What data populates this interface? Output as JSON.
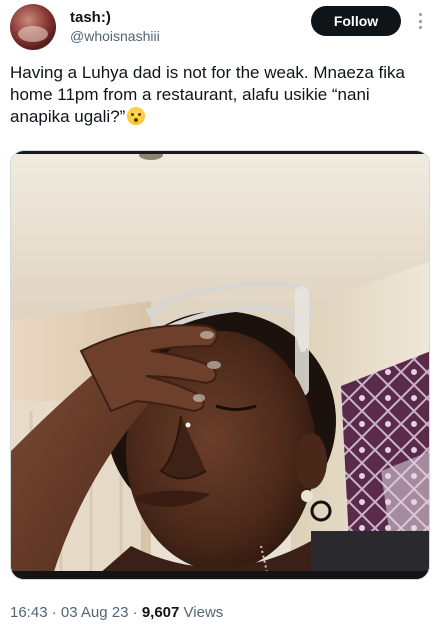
{
  "author": {
    "display_name": "tash:)",
    "handle": "@whoisnashiii"
  },
  "follow_button": {
    "label": "Follow"
  },
  "more_menu": {
    "icon": "more-vertical-icon"
  },
  "tweet": {
    "text": "Having a Luhya dad is not for the weak. Mnaeza fika home 11pm from a restaurant, alafu usikie “nani anapika ugali?”",
    "emoji": "flushed-face-emoji"
  },
  "media": {
    "type": "photo"
  },
  "meta": {
    "time": "16:43",
    "separator": "·",
    "date": "03 Aug 23",
    "views_count": "9,607",
    "views_label": "Views"
  },
  "colors": {
    "text_primary": "#0f1419",
    "text_secondary": "#536471",
    "follow_bg": "#0f1419",
    "border": "#cfd9de"
  }
}
